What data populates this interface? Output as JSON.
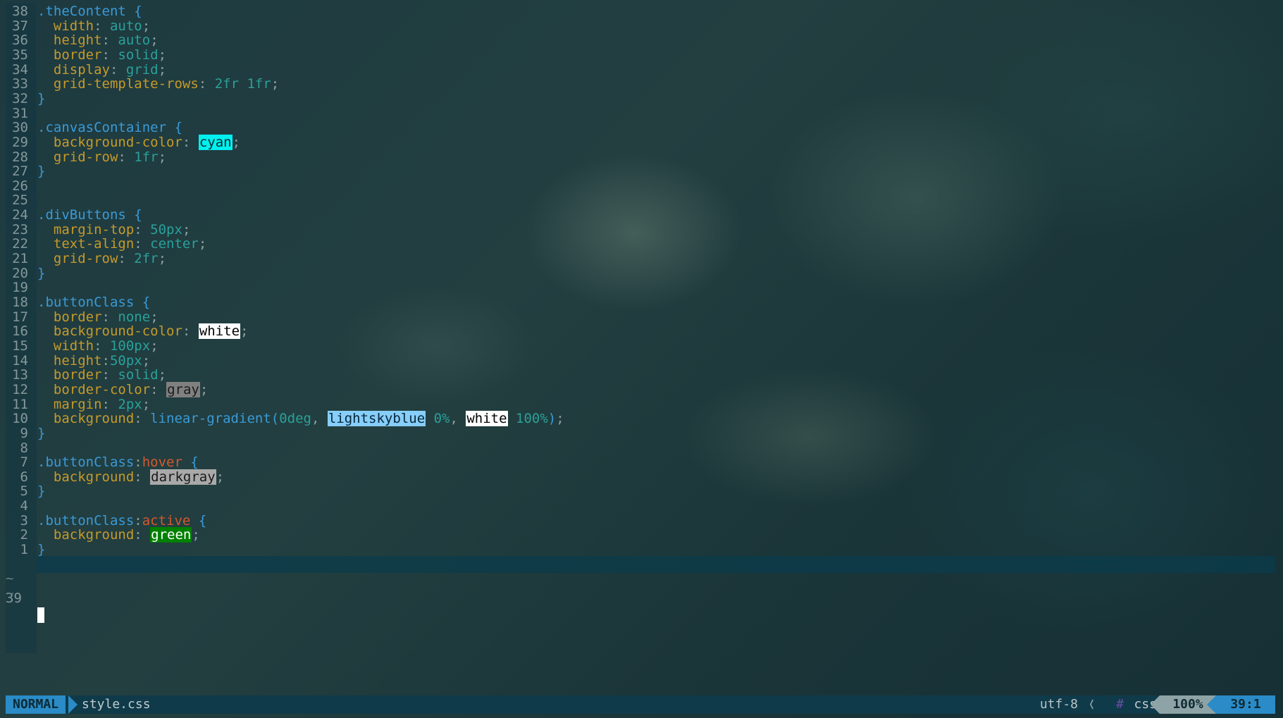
{
  "file": {
    "name": "style.css",
    "encoding": "utf-8",
    "filetype": "css",
    "filetype_icon": "#"
  },
  "mode": "NORMAL",
  "scroll_percent": "100%",
  "cursor_position": "39:1",
  "current_line_number": "39",
  "empty_marker": "~",
  "swatches": {
    "cyan": {
      "bg": "#00f0f0",
      "fg": "#002a2a"
    },
    "white": {
      "bg": "#ffffff",
      "fg": "#000000"
    },
    "gray": {
      "bg": "#808080",
      "fg": "#1a1a1a"
    },
    "lightskyblue": {
      "bg": "#87cefa",
      "fg": "#06263a"
    },
    "darkgray": {
      "bg": "#a9a9a9",
      "fg": "#1a1a1a"
    },
    "green": {
      "bg": "#008000",
      "fg": "#ffffff"
    }
  },
  "lines": [
    {
      "num": "38",
      "tokens": [
        [
          "sel",
          ".theContent"
        ],
        [
          "plain",
          " "
        ],
        [
          "brace",
          "{"
        ]
      ]
    },
    {
      "num": "37",
      "tokens": [
        [
          "plain",
          "  "
        ],
        [
          "prop",
          "width"
        ],
        [
          "colon",
          ": "
        ],
        [
          "val",
          "auto"
        ],
        [
          "semi",
          ";"
        ]
      ]
    },
    {
      "num": "36",
      "tokens": [
        [
          "plain",
          "  "
        ],
        [
          "prop",
          "height"
        ],
        [
          "colon",
          ": "
        ],
        [
          "val",
          "auto"
        ],
        [
          "semi",
          ";"
        ]
      ]
    },
    {
      "num": "35",
      "tokens": [
        [
          "plain",
          "  "
        ],
        [
          "prop",
          "border"
        ],
        [
          "colon",
          ": "
        ],
        [
          "val",
          "solid"
        ],
        [
          "semi",
          ";"
        ]
      ]
    },
    {
      "num": "34",
      "tokens": [
        [
          "plain",
          "  "
        ],
        [
          "prop",
          "display"
        ],
        [
          "colon",
          ": "
        ],
        [
          "val",
          "grid"
        ],
        [
          "semi",
          ";"
        ]
      ]
    },
    {
      "num": "33",
      "tokens": [
        [
          "plain",
          "  "
        ],
        [
          "prop",
          "grid-template-rows"
        ],
        [
          "colon",
          ": "
        ],
        [
          "val",
          "2fr 1fr"
        ],
        [
          "semi",
          ";"
        ]
      ]
    },
    {
      "num": "32",
      "tokens": [
        [
          "brace",
          "}"
        ]
      ]
    },
    {
      "num": "31",
      "tokens": []
    },
    {
      "num": "30",
      "tokens": [
        [
          "sel",
          ".canvasContainer"
        ],
        [
          "plain",
          " "
        ],
        [
          "brace",
          "{"
        ]
      ]
    },
    {
      "num": "29",
      "tokens": [
        [
          "plain",
          "  "
        ],
        [
          "prop",
          "background-color"
        ],
        [
          "colon",
          ": "
        ],
        [
          "swatch",
          "cyan"
        ],
        [
          "semi",
          ";"
        ]
      ]
    },
    {
      "num": "28",
      "tokens": [
        [
          "plain",
          "  "
        ],
        [
          "prop",
          "grid-row"
        ],
        [
          "colon",
          ": "
        ],
        [
          "val",
          "1fr"
        ],
        [
          "semi",
          ";"
        ]
      ]
    },
    {
      "num": "27",
      "tokens": [
        [
          "brace",
          "}"
        ]
      ]
    },
    {
      "num": "26",
      "tokens": []
    },
    {
      "num": "25",
      "tokens": []
    },
    {
      "num": "24",
      "tokens": [
        [
          "sel",
          ".divButtons"
        ],
        [
          "plain",
          " "
        ],
        [
          "brace",
          "{"
        ]
      ]
    },
    {
      "num": "23",
      "tokens": [
        [
          "plain",
          "  "
        ],
        [
          "prop",
          "margin-top"
        ],
        [
          "colon",
          ": "
        ],
        [
          "val",
          "50px"
        ],
        [
          "semi",
          ";"
        ]
      ]
    },
    {
      "num": "22",
      "tokens": [
        [
          "plain",
          "  "
        ],
        [
          "prop",
          "text-align"
        ],
        [
          "colon",
          ": "
        ],
        [
          "val",
          "center"
        ],
        [
          "semi",
          ";"
        ]
      ]
    },
    {
      "num": "21",
      "tokens": [
        [
          "plain",
          "  "
        ],
        [
          "prop",
          "grid-row"
        ],
        [
          "colon",
          ": "
        ],
        [
          "val",
          "2fr"
        ],
        [
          "semi",
          ";"
        ]
      ]
    },
    {
      "num": "20",
      "tokens": [
        [
          "brace",
          "}"
        ]
      ]
    },
    {
      "num": "19",
      "tokens": []
    },
    {
      "num": "18",
      "tokens": [
        [
          "sel",
          ".buttonClass"
        ],
        [
          "plain",
          " "
        ],
        [
          "brace",
          "{"
        ]
      ]
    },
    {
      "num": "17",
      "tokens": [
        [
          "plain",
          "  "
        ],
        [
          "prop",
          "border"
        ],
        [
          "colon",
          ": "
        ],
        [
          "val",
          "none"
        ],
        [
          "semi",
          ";"
        ]
      ]
    },
    {
      "num": "16",
      "tokens": [
        [
          "plain",
          "  "
        ],
        [
          "prop",
          "background-color"
        ],
        [
          "colon",
          ": "
        ],
        [
          "swatch",
          "white"
        ],
        [
          "semi",
          ";"
        ]
      ]
    },
    {
      "num": "15",
      "tokens": [
        [
          "plain",
          "  "
        ],
        [
          "prop",
          "width"
        ],
        [
          "colon",
          ": "
        ],
        [
          "val",
          "100px"
        ],
        [
          "semi",
          ";"
        ]
      ]
    },
    {
      "num": "14",
      "tokens": [
        [
          "plain",
          "  "
        ],
        [
          "prop",
          "height"
        ],
        [
          "colon",
          ":"
        ],
        [
          "val",
          "50px"
        ],
        [
          "semi",
          ";"
        ]
      ]
    },
    {
      "num": "13",
      "tokens": [
        [
          "plain",
          "  "
        ],
        [
          "prop",
          "border"
        ],
        [
          "colon",
          ": "
        ],
        [
          "val",
          "solid"
        ],
        [
          "semi",
          ";"
        ]
      ]
    },
    {
      "num": "12",
      "tokens": [
        [
          "plain",
          "  "
        ],
        [
          "prop",
          "border-color"
        ],
        [
          "colon",
          ": "
        ],
        [
          "swatch",
          "gray"
        ],
        [
          "semi",
          ";"
        ]
      ]
    },
    {
      "num": "11",
      "tokens": [
        [
          "plain",
          "  "
        ],
        [
          "prop",
          "margin"
        ],
        [
          "colon",
          ": "
        ],
        [
          "val",
          "2px"
        ],
        [
          "semi",
          ";"
        ]
      ]
    },
    {
      "num": "10",
      "tokens": [
        [
          "plain",
          "  "
        ],
        [
          "prop",
          "background"
        ],
        [
          "colon",
          ": "
        ],
        [
          "fn",
          "linear-gradient("
        ],
        [
          "val",
          "0deg"
        ],
        [
          "semi",
          ", "
        ],
        [
          "swatch",
          "lightskyblue"
        ],
        [
          "val",
          " 0%"
        ],
        [
          "semi",
          ", "
        ],
        [
          "swatch",
          "white"
        ],
        [
          "val",
          " 100%"
        ],
        [
          "fn",
          ")"
        ],
        [
          "semi",
          ";"
        ]
      ]
    },
    {
      "num": "9",
      "tokens": [
        [
          "brace",
          "}"
        ]
      ]
    },
    {
      "num": "8",
      "tokens": []
    },
    {
      "num": "7",
      "tokens": [
        [
          "sel",
          ".buttonClass"
        ],
        [
          "colon",
          ":"
        ],
        [
          "pseudo",
          "hover"
        ],
        [
          "plain",
          " "
        ],
        [
          "brace",
          "{"
        ]
      ]
    },
    {
      "num": "6",
      "tokens": [
        [
          "plain",
          "  "
        ],
        [
          "prop",
          "background"
        ],
        [
          "colon",
          ": "
        ],
        [
          "swatch",
          "darkgray"
        ],
        [
          "semi",
          ";"
        ]
      ]
    },
    {
      "num": "5",
      "tokens": [
        [
          "brace",
          "}"
        ]
      ]
    },
    {
      "num": "4",
      "tokens": []
    },
    {
      "num": "3",
      "tokens": [
        [
          "sel",
          ".buttonClass"
        ],
        [
          "colon",
          ":"
        ],
        [
          "pseudo",
          "active"
        ],
        [
          "plain",
          " "
        ],
        [
          "brace",
          "{"
        ]
      ]
    },
    {
      "num": "2",
      "tokens": [
        [
          "plain",
          "  "
        ],
        [
          "prop",
          "background"
        ],
        [
          "colon",
          ": "
        ],
        [
          "swatch",
          "green"
        ],
        [
          "semi",
          ";"
        ]
      ]
    },
    {
      "num": "1",
      "tokens": [
        [
          "brace",
          "}"
        ]
      ]
    }
  ]
}
